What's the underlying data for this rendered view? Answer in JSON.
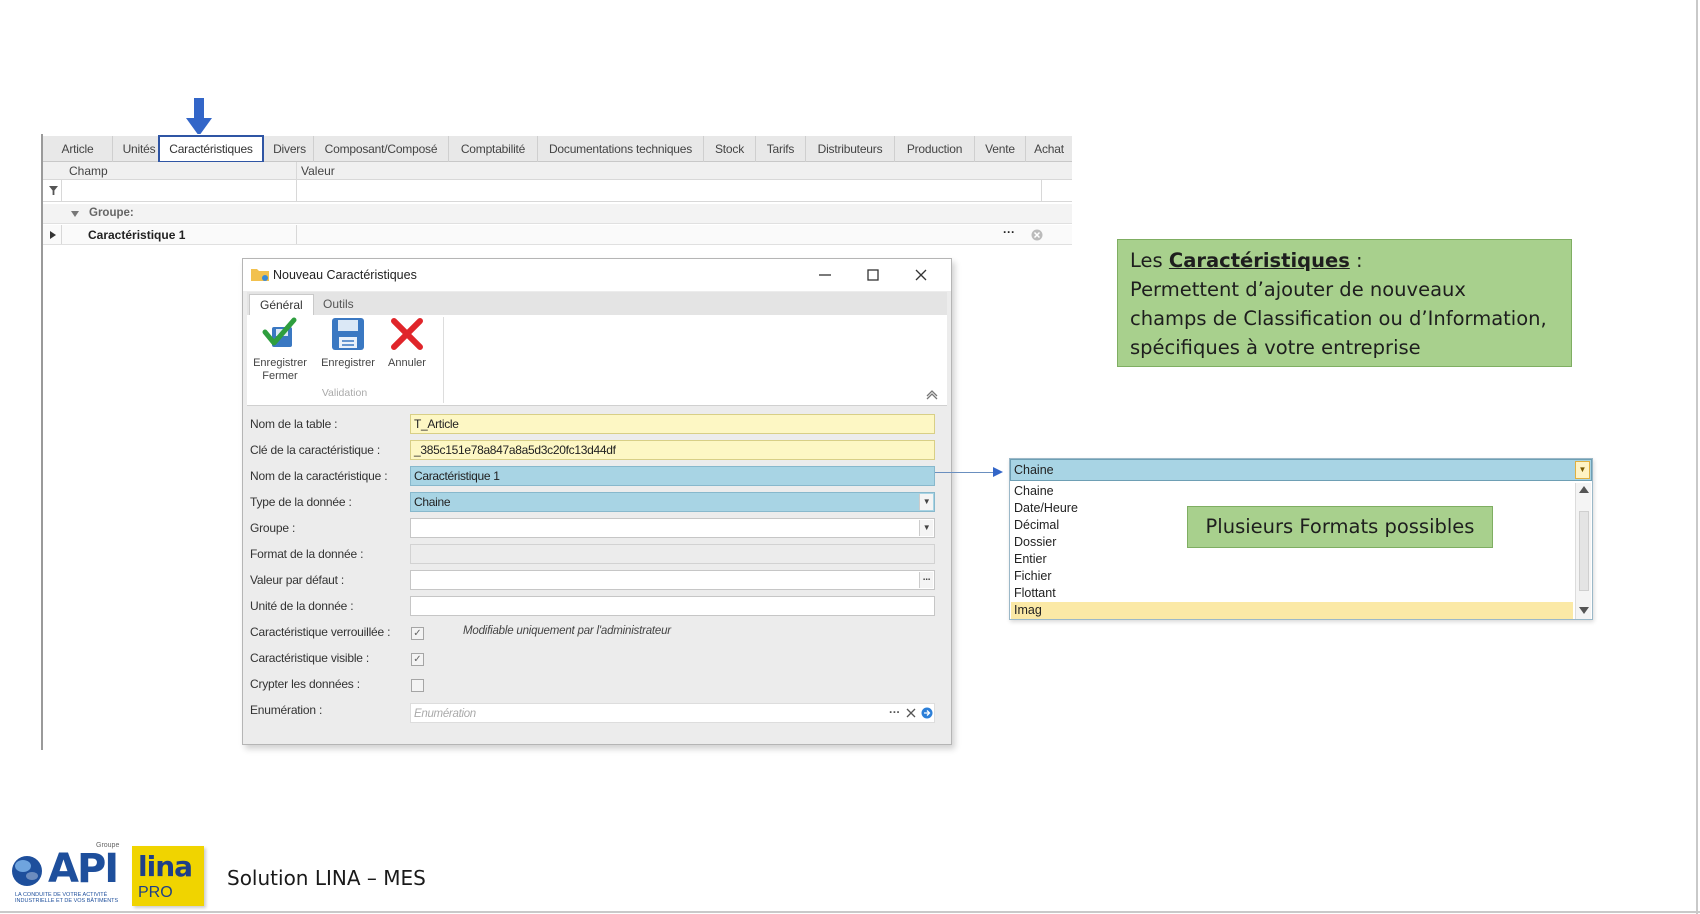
{
  "app": {
    "tabs": [
      "Article",
      "Unités",
      "Caractéristiques",
      "Divers",
      "Composant/Composé",
      "Comptabilité",
      "Documentations techniques",
      "Stock",
      "Tarifs",
      "Distributeurs",
      "Production",
      "Vente",
      "Achat"
    ],
    "active_tab": "Caractéristiques",
    "grid": {
      "col_field": "Champ",
      "col_value": "Valeur",
      "group_label": "Groupe:",
      "row_label": "Caractéristique 1",
      "row_more": "···"
    }
  },
  "dialog": {
    "title": "Nouveau Caractéristiques",
    "ribbon_tabs": [
      "Général",
      "Outils"
    ],
    "buttons": {
      "save_close_line1": "Enregistrer",
      "save_close_line2": "Fermer",
      "save": "Enregistrer",
      "cancel": "Annuler"
    },
    "ribbon_group": "Validation",
    "fields": {
      "table_label": "Nom de la table :",
      "table_value": "T_Article",
      "key_label": "Clé de la caractéristique :",
      "key_value": "_385c151e78a847a8a5d3c20fc13d44df",
      "name_label": "Nom de la caractéristique :",
      "name_value": "Caractéristique 1",
      "type_label": "Type de la donnée :",
      "type_value": "Chaine",
      "group_label": "Groupe :",
      "group_value": "",
      "format_label": "Format de la donnée :",
      "default_label": "Valeur par défaut :",
      "default_value": "",
      "unit_label": "Unité de la donnée :",
      "unit_value": "",
      "locked_label": "Caractéristique verrouillée :",
      "locked_note": "Modifiable uniquement par l'administrateur",
      "visible_label": "Caractéristique visible :",
      "encrypt_label": "Crypter les données :",
      "enum_label": "Enumération :",
      "enum_placeholder": "Enumération"
    },
    "checks": {
      "locked": true,
      "visible": true,
      "encrypt": false
    }
  },
  "callout_main": {
    "prefix": "Les ",
    "keyword": "Caractéristiques",
    "suffix": " :",
    "line1": "Permettent d’ajouter de nouveaux",
    "line2": "champs de Classification ou d’Information,",
    "line3": "spécifiques à votre entreprise"
  },
  "callout_formats": "Plusieurs Formats possibles",
  "dropdown": {
    "selected": "Chaine",
    "options": [
      "Chaine",
      "Date/Heure",
      "Décimal",
      "Dossier",
      "Entier",
      "Fichier",
      "Flottant",
      "Imag"
    ],
    "highlighted": "Imag"
  },
  "footer": {
    "logo_api": "API",
    "logo_group": "Groupe",
    "logo_tagline": "LA CONDUITE DE VOTRE ACTIVITÉ INDUSTRIELLE ET DE VOS BÂTIMENTS",
    "logo_lina": "lina",
    "logo_pro": "PRO",
    "text": "Solution LINA – MES"
  },
  "colors": {
    "callout_green": "#a8d08d",
    "selection_blue": "#a8d4e4",
    "readonly_yellow": "#fdf7c4",
    "arrow_blue": "#3366c8",
    "check_green": "#2e9e3e",
    "cancel_red": "#e0252a"
  },
  "icons": [
    "down-arrow-icon",
    "folder-icon",
    "minimize-icon",
    "maximize-icon",
    "close-icon",
    "save-close-icon",
    "save-icon",
    "cancel-icon",
    "collapse-ribbon-icon",
    "ellipsis-icon",
    "clear-icon",
    "go-icon",
    "filter-icon",
    "row-expand-icon",
    "group-collapse-icon"
  ]
}
